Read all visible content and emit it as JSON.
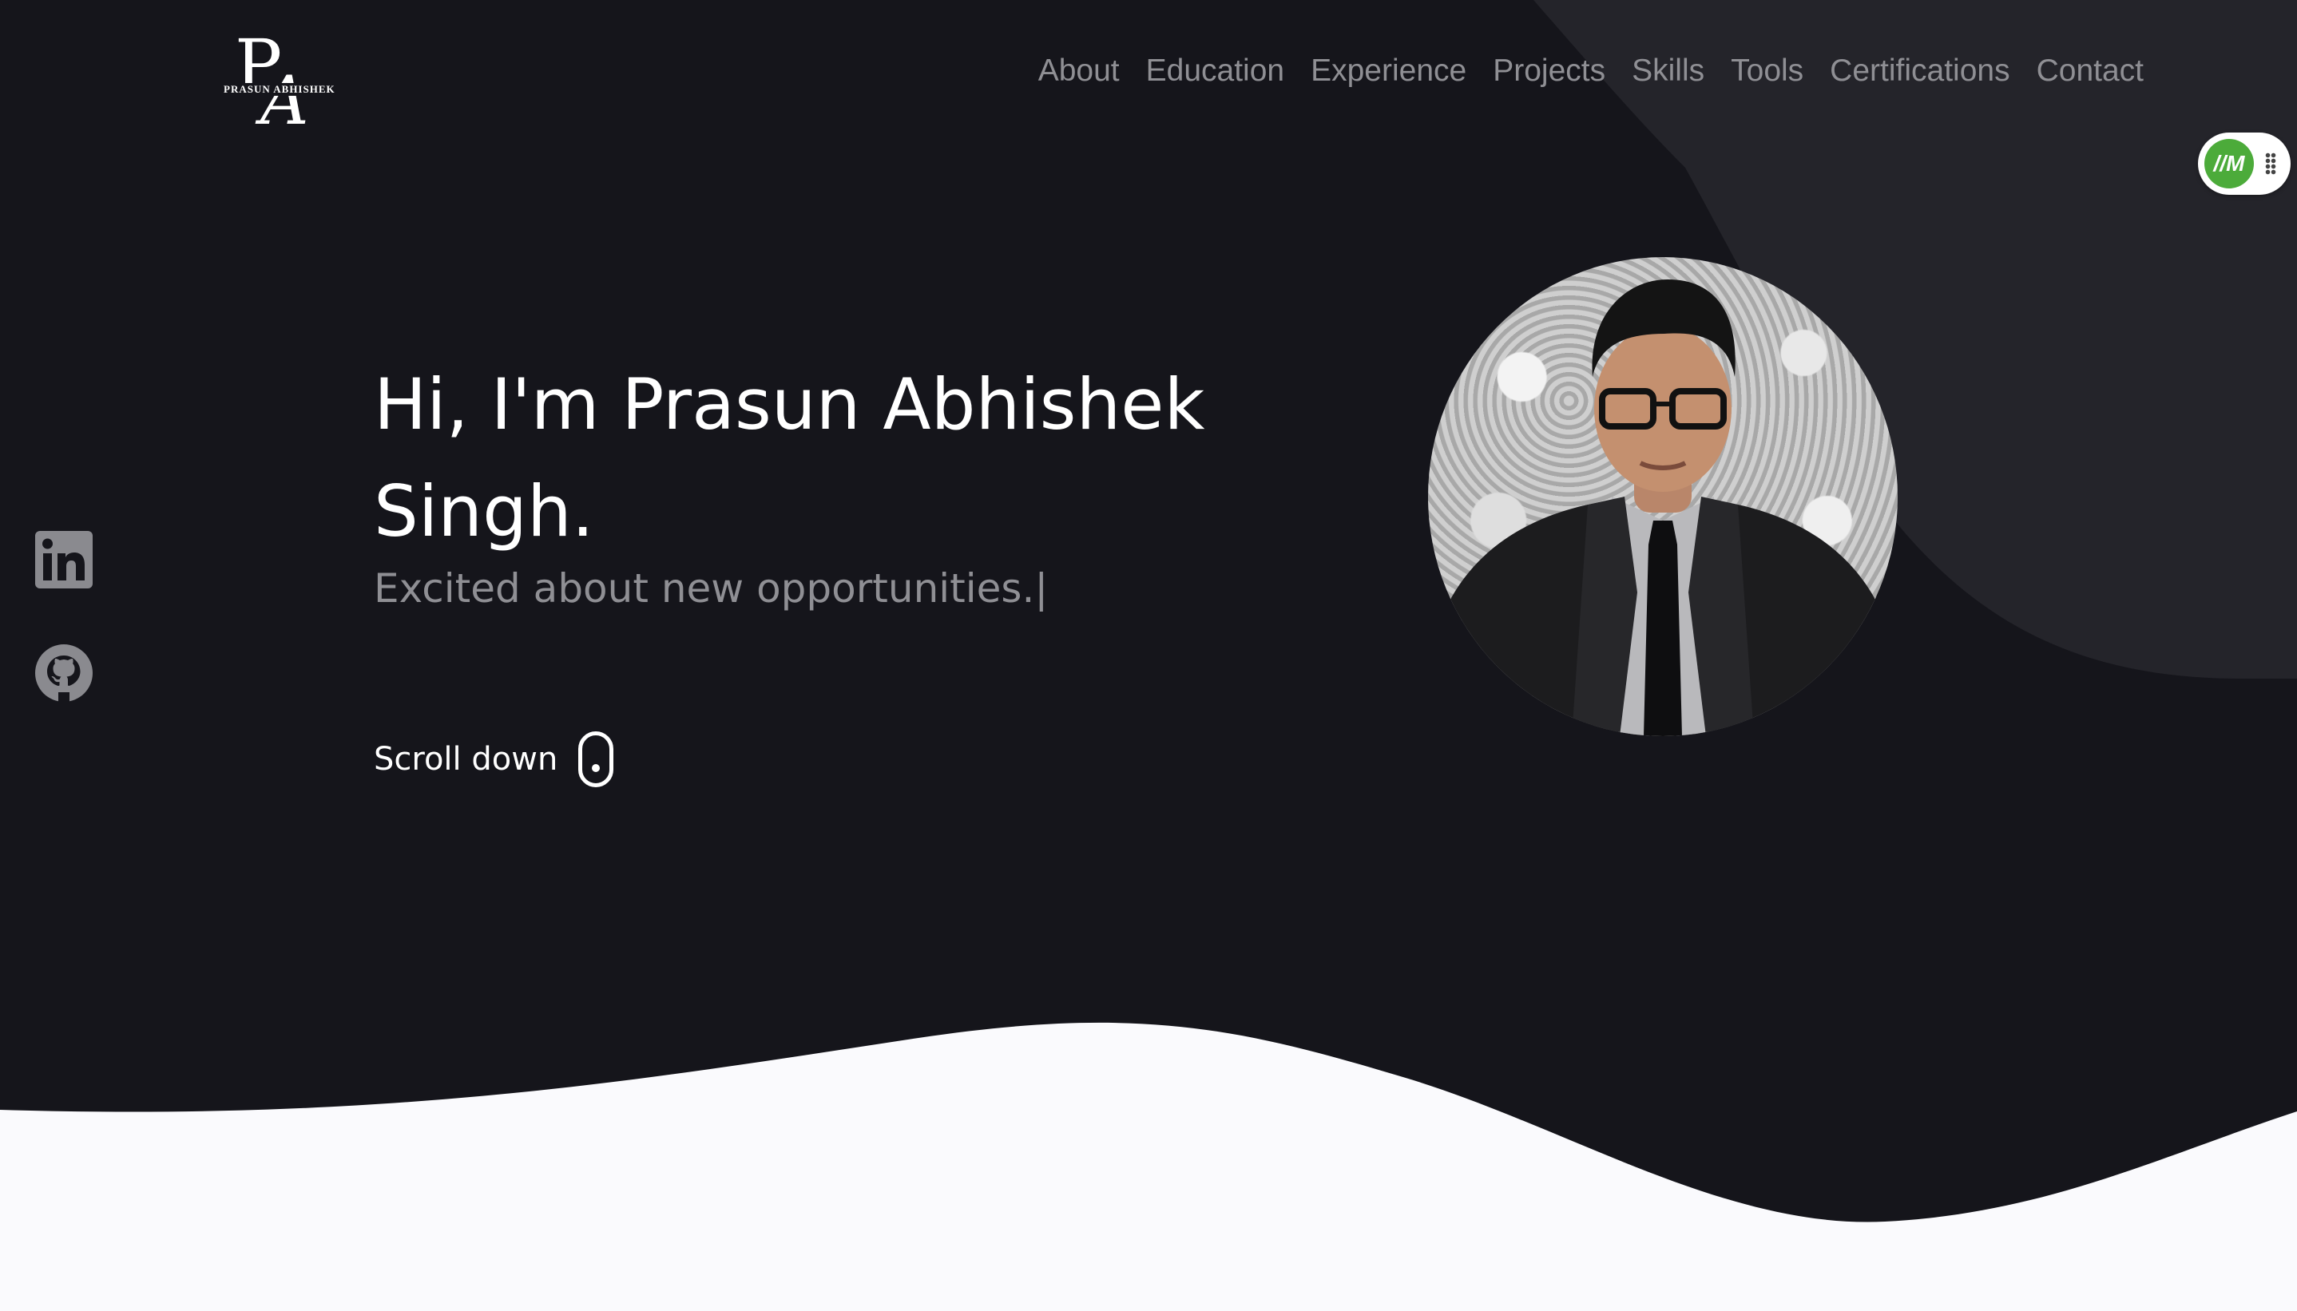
{
  "logo": {
    "monogram_p": "P",
    "monogram_a": "A",
    "name": "PRASUN ABHISHEK"
  },
  "nav": {
    "items": [
      {
        "label": "About"
      },
      {
        "label": "Education"
      },
      {
        "label": "Experience"
      },
      {
        "label": "Projects"
      },
      {
        "label": "Skills"
      },
      {
        "label": "Tools"
      },
      {
        "label": "Certifications"
      },
      {
        "label": "Contact"
      }
    ]
  },
  "extension": {
    "badge": "//М"
  },
  "social": {
    "items": [
      {
        "icon": "linkedin-icon"
      },
      {
        "icon": "github-icon"
      }
    ]
  },
  "hero": {
    "title": "Hi, I'm Prasun Abhishek Singh.",
    "subtitle": "Excited about new opportunities.|",
    "scroll_label": "Scroll down"
  },
  "colors": {
    "background": "#15151b",
    "panel": "#24242a",
    "wave": "#fafafd",
    "text_primary": "#ffffff",
    "text_muted": "#8f8f94",
    "extension_accent": "#4cab3a"
  }
}
